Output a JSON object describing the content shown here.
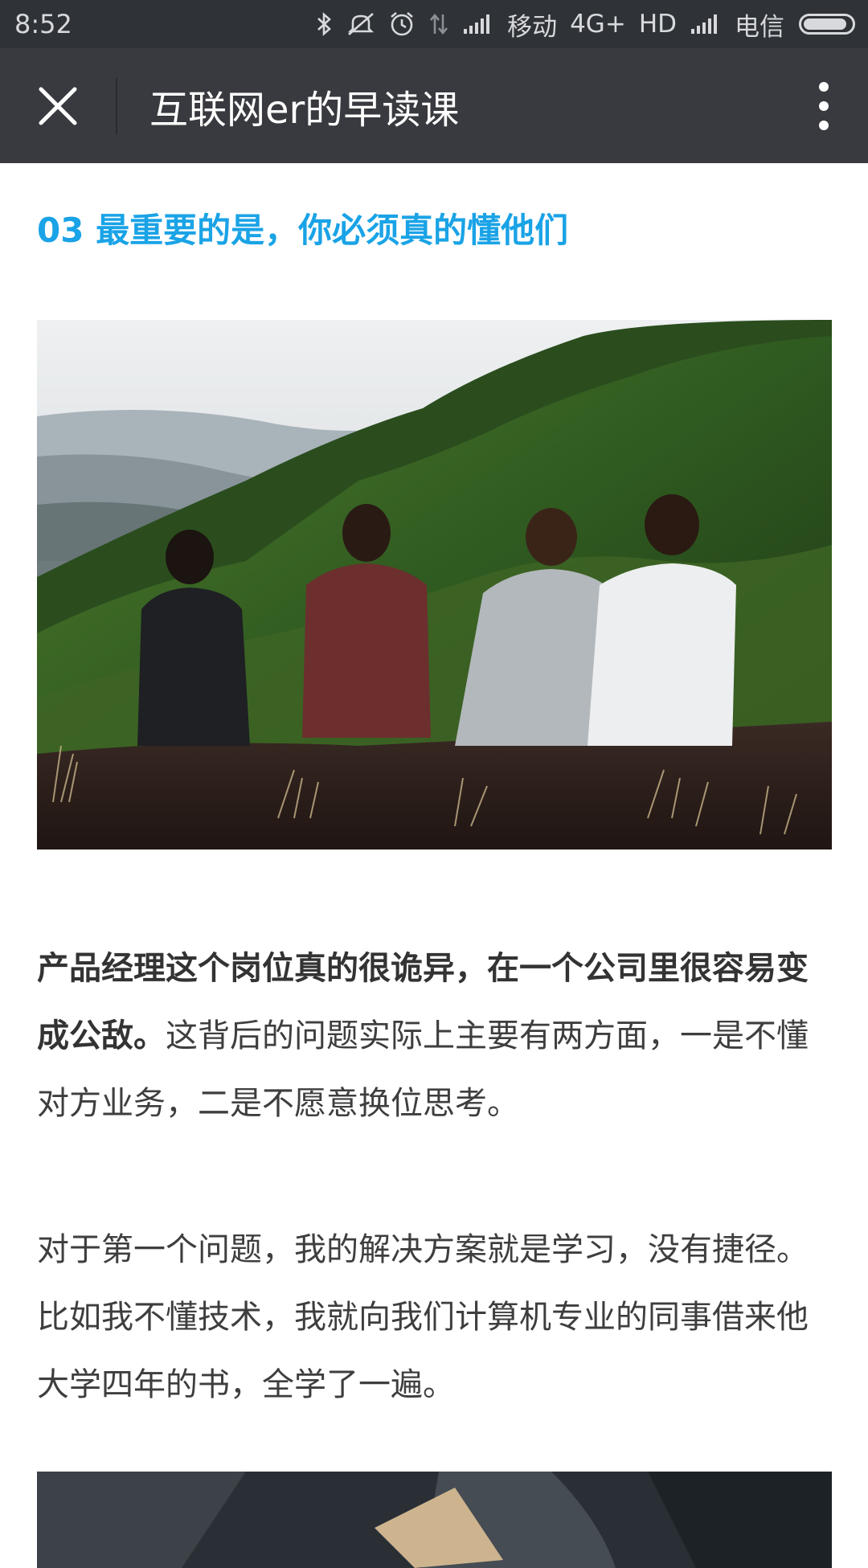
{
  "status_bar": {
    "time": "8:52",
    "carrier1": "移动",
    "network1": "4G+",
    "hd": "HD",
    "carrier2": "电信",
    "icons": [
      "bluetooth-icon",
      "mute-icon",
      "alarm-icon",
      "data-arrows-icon",
      "signal-icon",
      "signal-icon",
      "battery-icon"
    ]
  },
  "header": {
    "title": "互联网er的早读课",
    "close_icon": "close-icon",
    "more_icon": "more-vertical-icon"
  },
  "article": {
    "section_title": "03 最重要的是，你必须真的懂他们",
    "paragraph1_bold": "产品经理这个岗位真的很诡异，在一个公司里很容易变成公敌。",
    "paragraph1_rest": "这背后的问题实际上主要有两方面，一是不懂对方业务，二是不愿意换位思考。",
    "paragraph2": "对于第一个问题，我的解决方案就是学习，没有捷径。比如我不懂技术，我就向我们计算机专业的同事借来他大学四年的书，全学了一遍。"
  },
  "colors": {
    "status_bar_bg": "#2f3237",
    "header_bg": "#393a3f",
    "section_title": "#1aa3e6",
    "body_text": "#3e3e3e"
  }
}
